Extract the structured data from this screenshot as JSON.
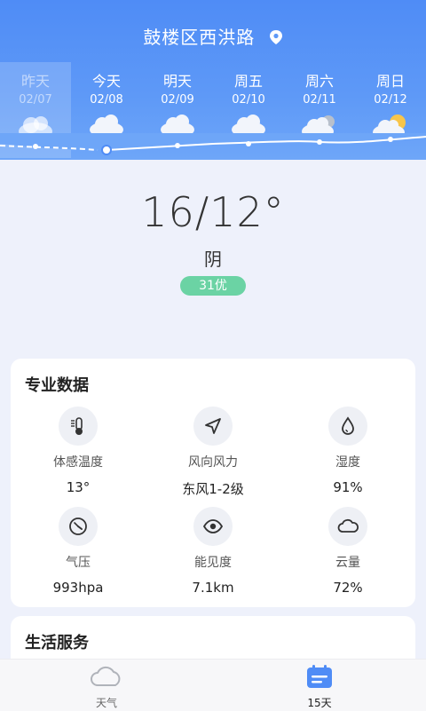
{
  "header": {
    "location": "鼓楼区西洪路"
  },
  "days": [
    {
      "name": "昨天",
      "date": "02/07",
      "icon": "cloud-icon"
    },
    {
      "name": "今天",
      "date": "02/08",
      "icon": "cloud-rain-icon"
    },
    {
      "name": "明天",
      "date": "02/09",
      "icon": "cloud-rain-icon"
    },
    {
      "name": "周五",
      "date": "02/10",
      "icon": "cloud-rain-icon"
    },
    {
      "name": "周六",
      "date": "02/11",
      "icon": "cloudy-icon"
    },
    {
      "name": "周日",
      "date": "02/12",
      "icon": "partly-sunny-icon"
    }
  ],
  "current": {
    "temp": "16/12°",
    "condition": "阴",
    "aqi": "31优"
  },
  "pro": {
    "title": "专业数据",
    "items": [
      {
        "label": "体感温度",
        "value": "13°",
        "icon": "thermometer-icon"
      },
      {
        "label": "风向风力",
        "value": "东风1-2级",
        "icon": "wind-direction-icon"
      },
      {
        "label": "湿度",
        "value": "91%",
        "icon": "humidity-drop-icon"
      },
      {
        "label": "气压",
        "value": "993hpa",
        "icon": "pressure-gauge-icon"
      },
      {
        "label": "能见度",
        "value": "7.1km",
        "icon": "visibility-eye-icon"
      },
      {
        "label": "云量",
        "value": "72%",
        "icon": "cloud-amount-icon"
      }
    ]
  },
  "life": {
    "title": "生活服务"
  },
  "tabs": [
    {
      "label": "天气",
      "icon": "weather-icon",
      "active": false
    },
    {
      "label": "15天",
      "icon": "calendar-icon",
      "active": true
    }
  ],
  "colors": {
    "header": "#4f8cf6",
    "aqi": "#6bd3a4",
    "accent": "#4f8cf6"
  }
}
